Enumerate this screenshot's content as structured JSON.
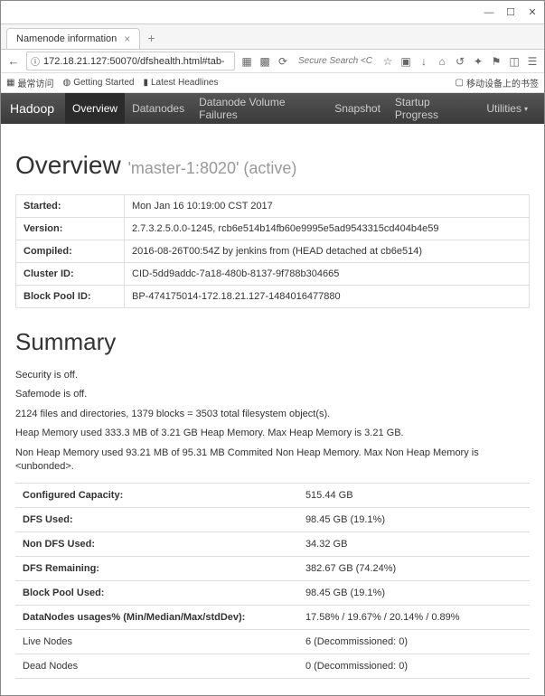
{
  "window": {
    "tab_title": "Namenode information"
  },
  "url": "172.18.21.127:50070/dfshealth.html#tab-",
  "search_placeholder": "Secure Search <C",
  "bookmarks": {
    "most_visited": "最常访问",
    "getting_started": "Getting Started",
    "latest": "Latest Headlines",
    "mobile": "移动设备上的书签"
  },
  "nav": {
    "brand": "Hadoop",
    "overview": "Overview",
    "datanodes": "Datanodes",
    "volume": "Datanode Volume Failures",
    "snapshot": "Snapshot",
    "startup": "Startup Progress",
    "utilities": "Utilities"
  },
  "overview": {
    "heading": "Overview",
    "sub": "'master-1:8020' (active)",
    "rows": {
      "started_label": "Started:",
      "started_val": "Mon Jan 16 10:19:00 CST 2017",
      "version_label": "Version:",
      "version_val": "2.7.3.2.5.0.0-1245, rcb6e514b14fb60e9995e5ad9543315cd404b4e59",
      "compiled_label": "Compiled:",
      "compiled_val": "2016-08-26T00:54Z by jenkins from (HEAD detached at cb6e514)",
      "cluster_label": "Cluster ID:",
      "cluster_val": "CID-5dd9addc-7a18-480b-8137-9f788b304665",
      "pool_label": "Block Pool ID:",
      "pool_val": "BP-474175014-172.18.21.127-1484016477880"
    }
  },
  "summary": {
    "heading": "Summary",
    "text": {
      "security": "Security is off.",
      "safemode": "Safemode is off.",
      "files": "2124 files and directories, 1379 blocks = 3503 total filesystem object(s).",
      "heap": "Heap Memory used 333.3 MB of 3.21 GB Heap Memory. Max Heap Memory is 3.21 GB.",
      "nonheap": "Non Heap Memory used 93.21 MB of 95.31 MB Commited Non Heap Memory. Max Non Heap Memory is <unbonded>."
    },
    "rows": {
      "cap_label": "Configured Capacity:",
      "cap_val": "515.44 GB",
      "dfs_label": "DFS Used:",
      "dfs_val": "98.45 GB (19.1%)",
      "non_label": "Non DFS Used:",
      "non_val": "34.32 GB",
      "rem_label": "DFS Remaining:",
      "rem_val": "382.67 GB (74.24%)",
      "bp_label": "Block Pool Used:",
      "bp_val": "98.45 GB (19.1%)",
      "dn_label": "DataNodes usages% (Min/Median/Max/stdDev):",
      "dn_val": "17.58% / 19.67% / 20.14% / 0.89%",
      "live_label": "Live Nodes",
      "live_val": "6 (Decommissioned: 0)",
      "dead_label": "Dead Nodes",
      "dead_val": "0 (Decommissioned: 0)"
    }
  }
}
